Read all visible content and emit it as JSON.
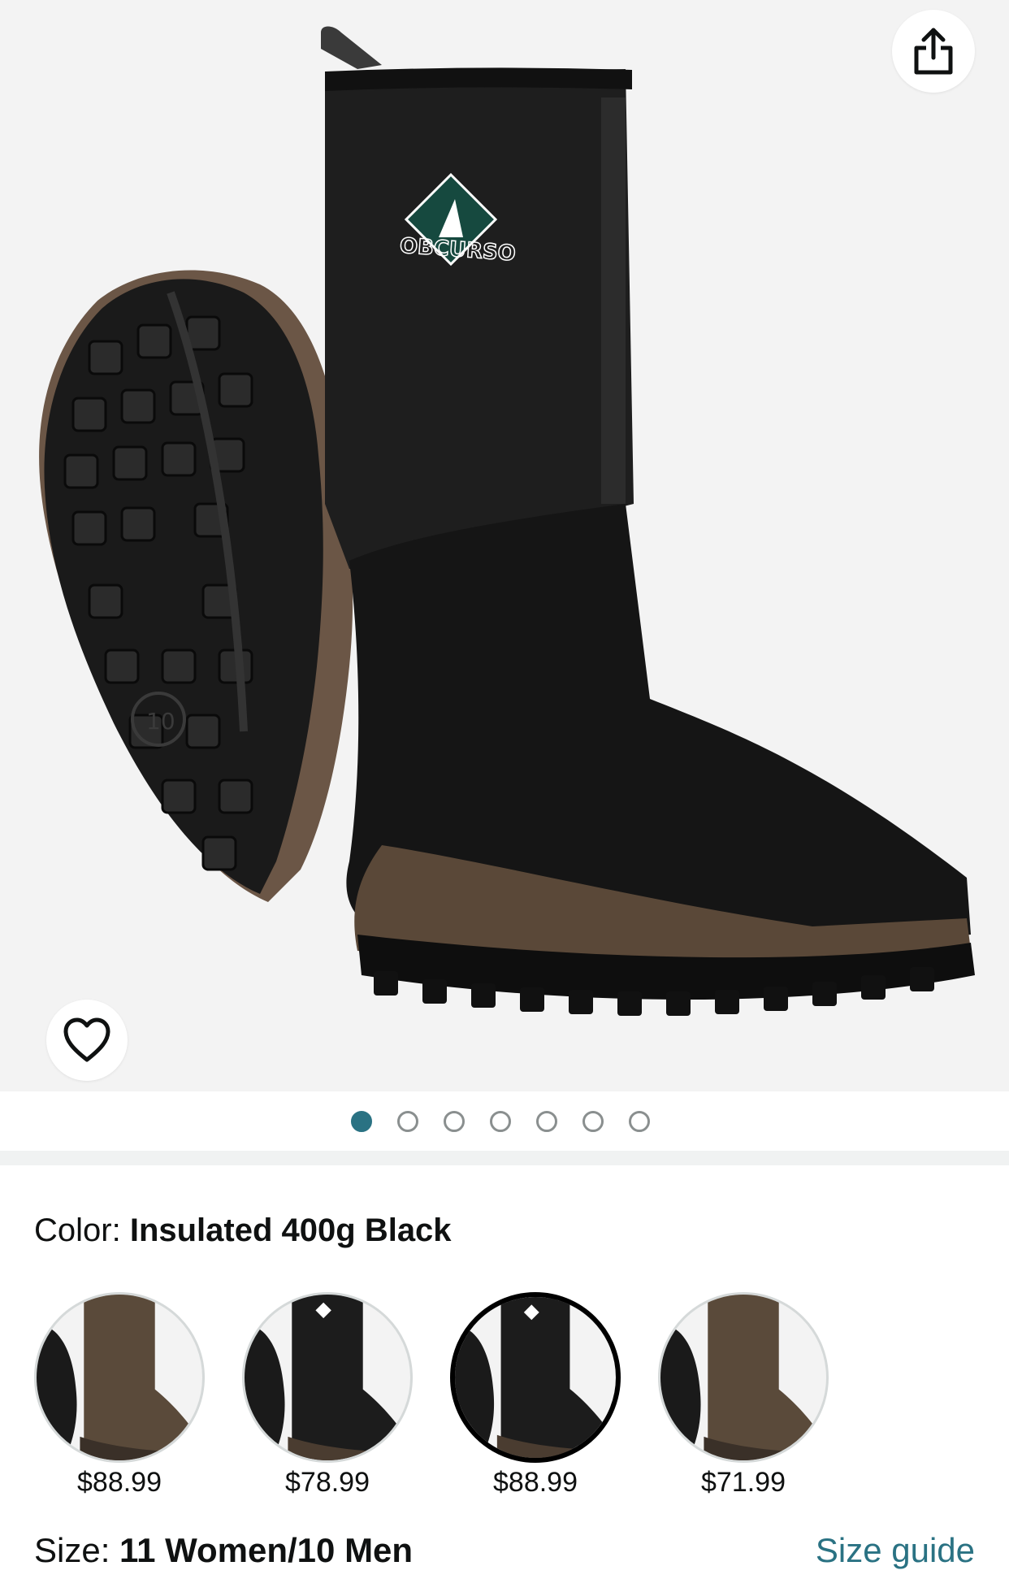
{
  "gallery": {
    "brand_text": "OBCURSO",
    "sole_number": "10",
    "page_count": 7,
    "active_page": 1
  },
  "icons": {
    "share": "share-icon",
    "wishlist": "heart-outline-icon"
  },
  "color": {
    "label": "Color:",
    "selected_value": "Insulated 400g Black"
  },
  "swatches": [
    {
      "price": "$88.99",
      "shaft_color": "#5a4a3a",
      "selected": false
    },
    {
      "price": "$78.99",
      "shaft_color": "#1c1c1c",
      "selected": false
    },
    {
      "price": "$88.99",
      "shaft_color": "#1c1c1c",
      "selected": true
    },
    {
      "price": "$71.99",
      "shaft_color": "#5a4a3a",
      "selected": false
    }
  ],
  "size": {
    "label": "Size:",
    "selected_value": "11 Women/10 Men",
    "guide_link": "Size guide"
  },
  "colors": {
    "accent": "#2a7283",
    "text": "#0f1111",
    "gallery_bg": "#f3f3f3"
  }
}
